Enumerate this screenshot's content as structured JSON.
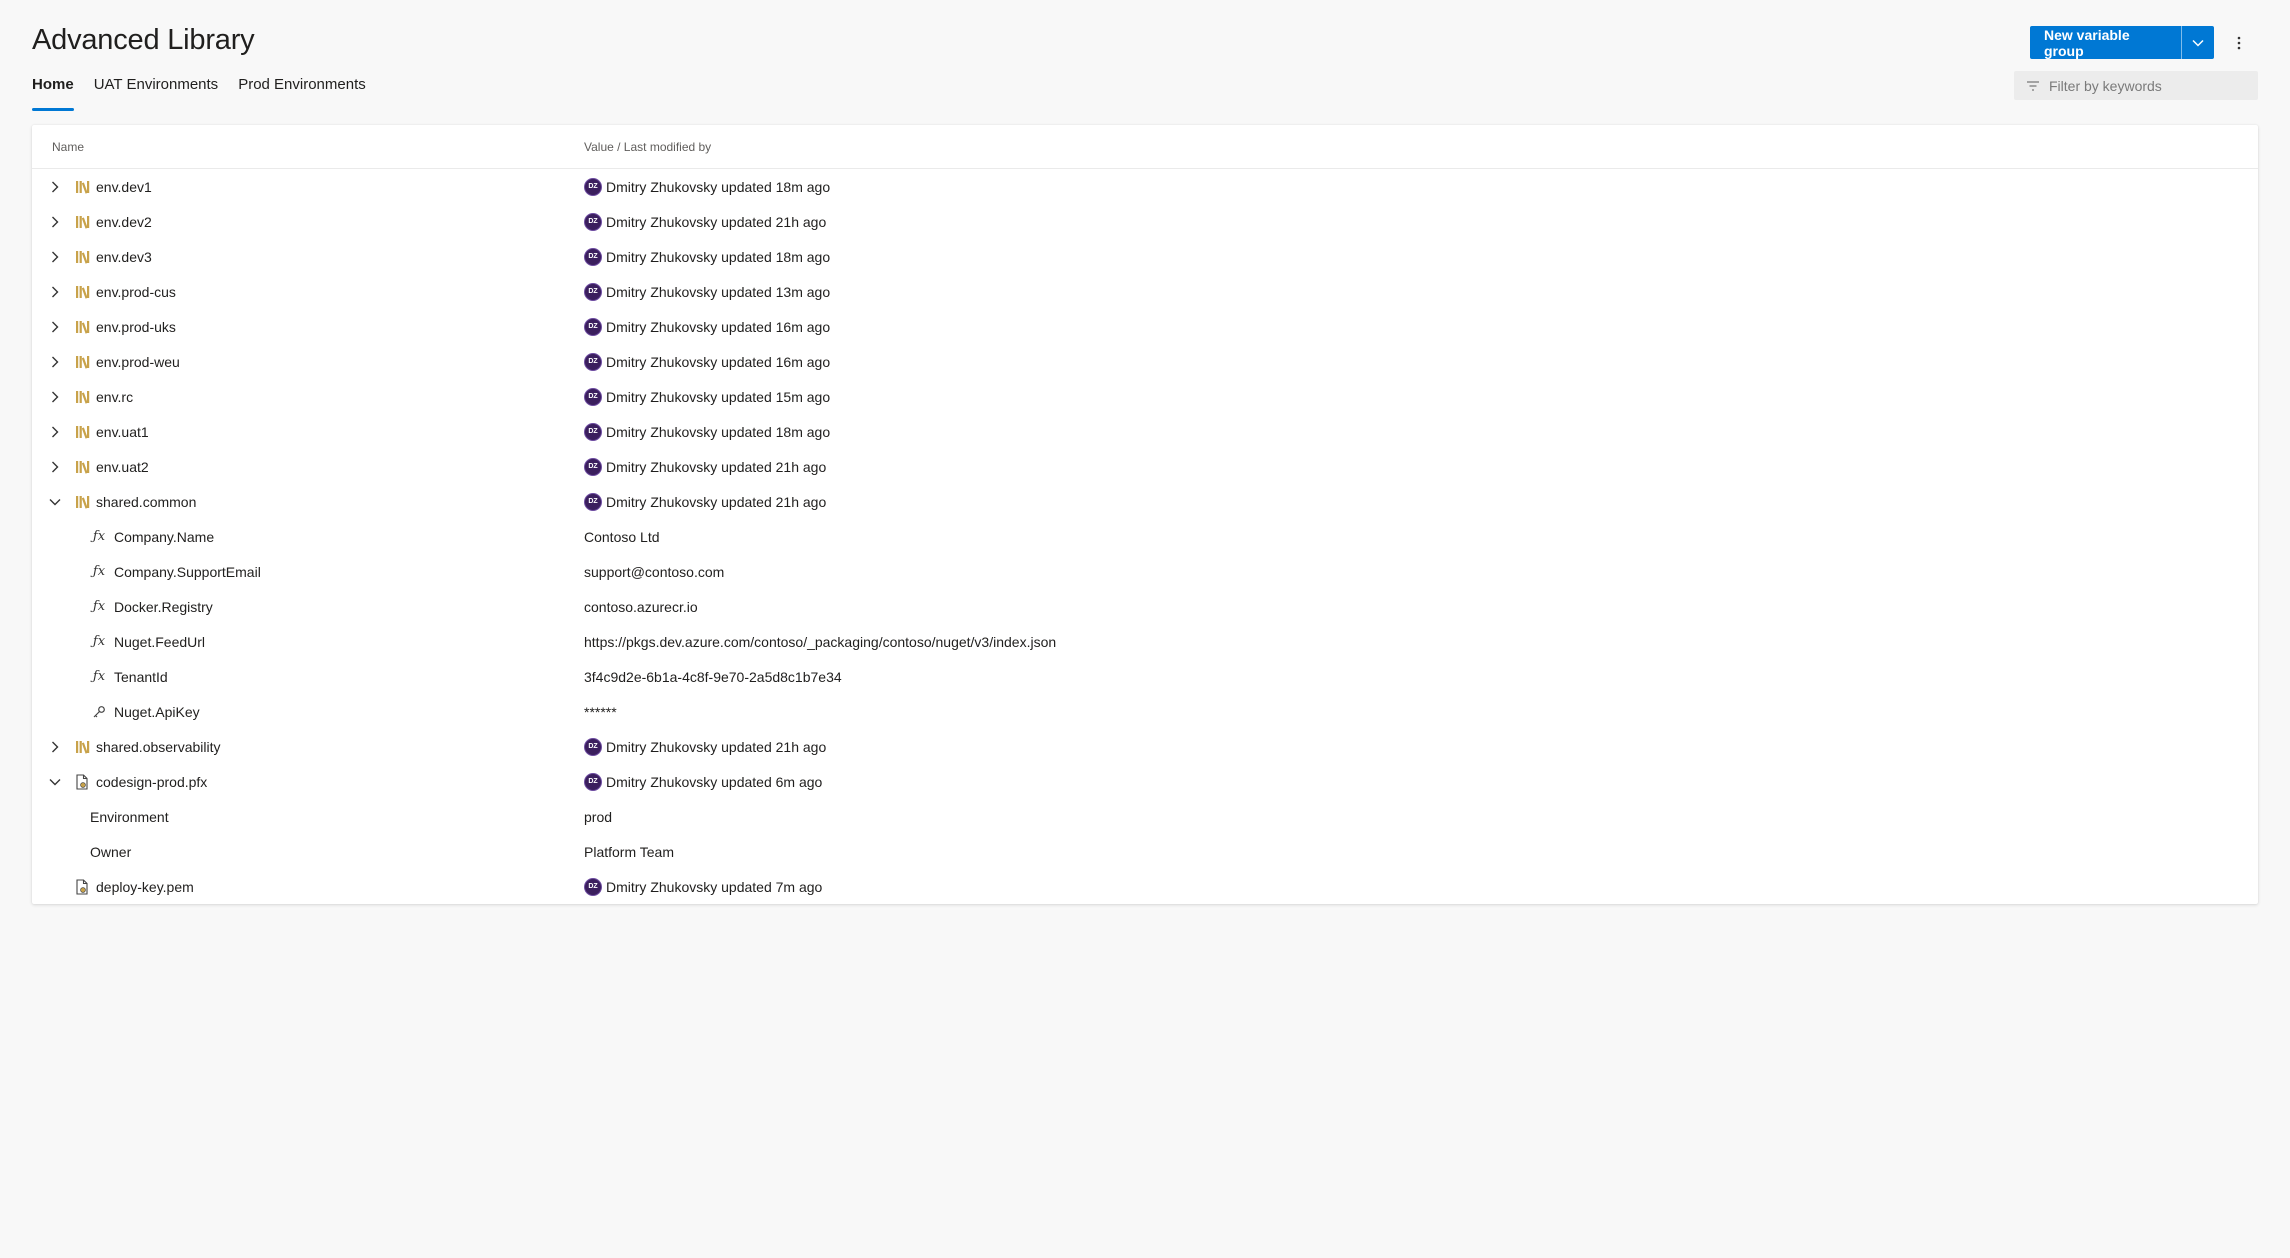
{
  "header": {
    "title": "Advanced Library",
    "new_button_label": "New variable group",
    "filter_placeholder": "Filter by keywords"
  },
  "tabs": [
    {
      "label": "Home",
      "active": true
    },
    {
      "label": "UAT Environments",
      "active": false
    },
    {
      "label": "Prod Environments",
      "active": false
    }
  ],
  "table": {
    "columns": [
      "Name",
      "Value / Last modified by"
    ],
    "rows": [
      {
        "kind": "group",
        "expanded": false,
        "icon": "library-icon",
        "name": "env.dev1",
        "user_initials": "DZ",
        "modified": "Dmitry Zhukovsky updated 18m ago"
      },
      {
        "kind": "group",
        "expanded": false,
        "icon": "library-icon",
        "name": "env.dev2",
        "user_initials": "DZ",
        "modified": "Dmitry Zhukovsky updated 21h ago"
      },
      {
        "kind": "group",
        "expanded": false,
        "icon": "library-icon",
        "name": "env.dev3",
        "user_initials": "DZ",
        "modified": "Dmitry Zhukovsky updated 18m ago"
      },
      {
        "kind": "group",
        "expanded": false,
        "icon": "library-icon",
        "name": "env.prod-cus",
        "user_initials": "DZ",
        "modified": "Dmitry Zhukovsky updated 13m ago"
      },
      {
        "kind": "group",
        "expanded": false,
        "icon": "library-icon",
        "name": "env.prod-uks",
        "user_initials": "DZ",
        "modified": "Dmitry Zhukovsky updated 16m ago"
      },
      {
        "kind": "group",
        "expanded": false,
        "icon": "library-icon",
        "name": "env.prod-weu",
        "user_initials": "DZ",
        "modified": "Dmitry Zhukovsky updated 16m ago"
      },
      {
        "kind": "group",
        "expanded": false,
        "icon": "library-icon",
        "name": "env.rc",
        "user_initials": "DZ",
        "modified": "Dmitry Zhukovsky updated 15m ago"
      },
      {
        "kind": "group",
        "expanded": false,
        "icon": "library-icon",
        "name": "env.uat1",
        "user_initials": "DZ",
        "modified": "Dmitry Zhukovsky updated 18m ago"
      },
      {
        "kind": "group",
        "expanded": false,
        "icon": "library-icon",
        "name": "env.uat2",
        "user_initials": "DZ",
        "modified": "Dmitry Zhukovsky updated 21h ago"
      },
      {
        "kind": "group",
        "expanded": true,
        "icon": "library-icon",
        "name": "shared.common",
        "user_initials": "DZ",
        "modified": "Dmitry Zhukovsky updated 21h ago"
      },
      {
        "kind": "var",
        "icon": "fx-icon",
        "name": "Company.Name",
        "value": "Contoso Ltd"
      },
      {
        "kind": "var",
        "icon": "fx-icon",
        "name": "Company.SupportEmail",
        "value": "support@contoso.com"
      },
      {
        "kind": "var",
        "icon": "fx-icon",
        "name": "Docker.Registry",
        "value": "contoso.azurecr.io"
      },
      {
        "kind": "var",
        "icon": "fx-icon",
        "name": "Nuget.FeedUrl",
        "value": "https://pkgs.dev.azure.com/contoso/_packaging/contoso/nuget/v3/index.json"
      },
      {
        "kind": "var",
        "icon": "fx-icon",
        "name": "TenantId",
        "value": "3f4c9d2e-6b1a-4c8f-9e70-2a5d8c1b7e34"
      },
      {
        "kind": "var",
        "icon": "key-icon",
        "name": "Nuget.ApiKey",
        "value": "******"
      },
      {
        "kind": "group",
        "expanded": false,
        "icon": "library-icon",
        "name": "shared.observability",
        "user_initials": "DZ",
        "modified": "Dmitry Zhukovsky updated 21h ago"
      },
      {
        "kind": "group",
        "expanded": true,
        "icon": "secure-file-icon",
        "name": "codesign-prod.pfx",
        "user_initials": "DZ",
        "modified": "Dmitry Zhukovsky updated 6m ago"
      },
      {
        "kind": "prop",
        "name": "Environment",
        "value": "prod"
      },
      {
        "kind": "prop",
        "name": "Owner",
        "value": "Platform Team"
      },
      {
        "kind": "file",
        "icon": "secure-file-icon",
        "name": "deploy-key.pem",
        "user_initials": "DZ",
        "modified": "Dmitry Zhukovsky updated 7m ago"
      }
    ]
  },
  "colors": {
    "accent": "#0078d4",
    "library_icon": "#c8a24a",
    "avatar": "#3b1f5e"
  }
}
